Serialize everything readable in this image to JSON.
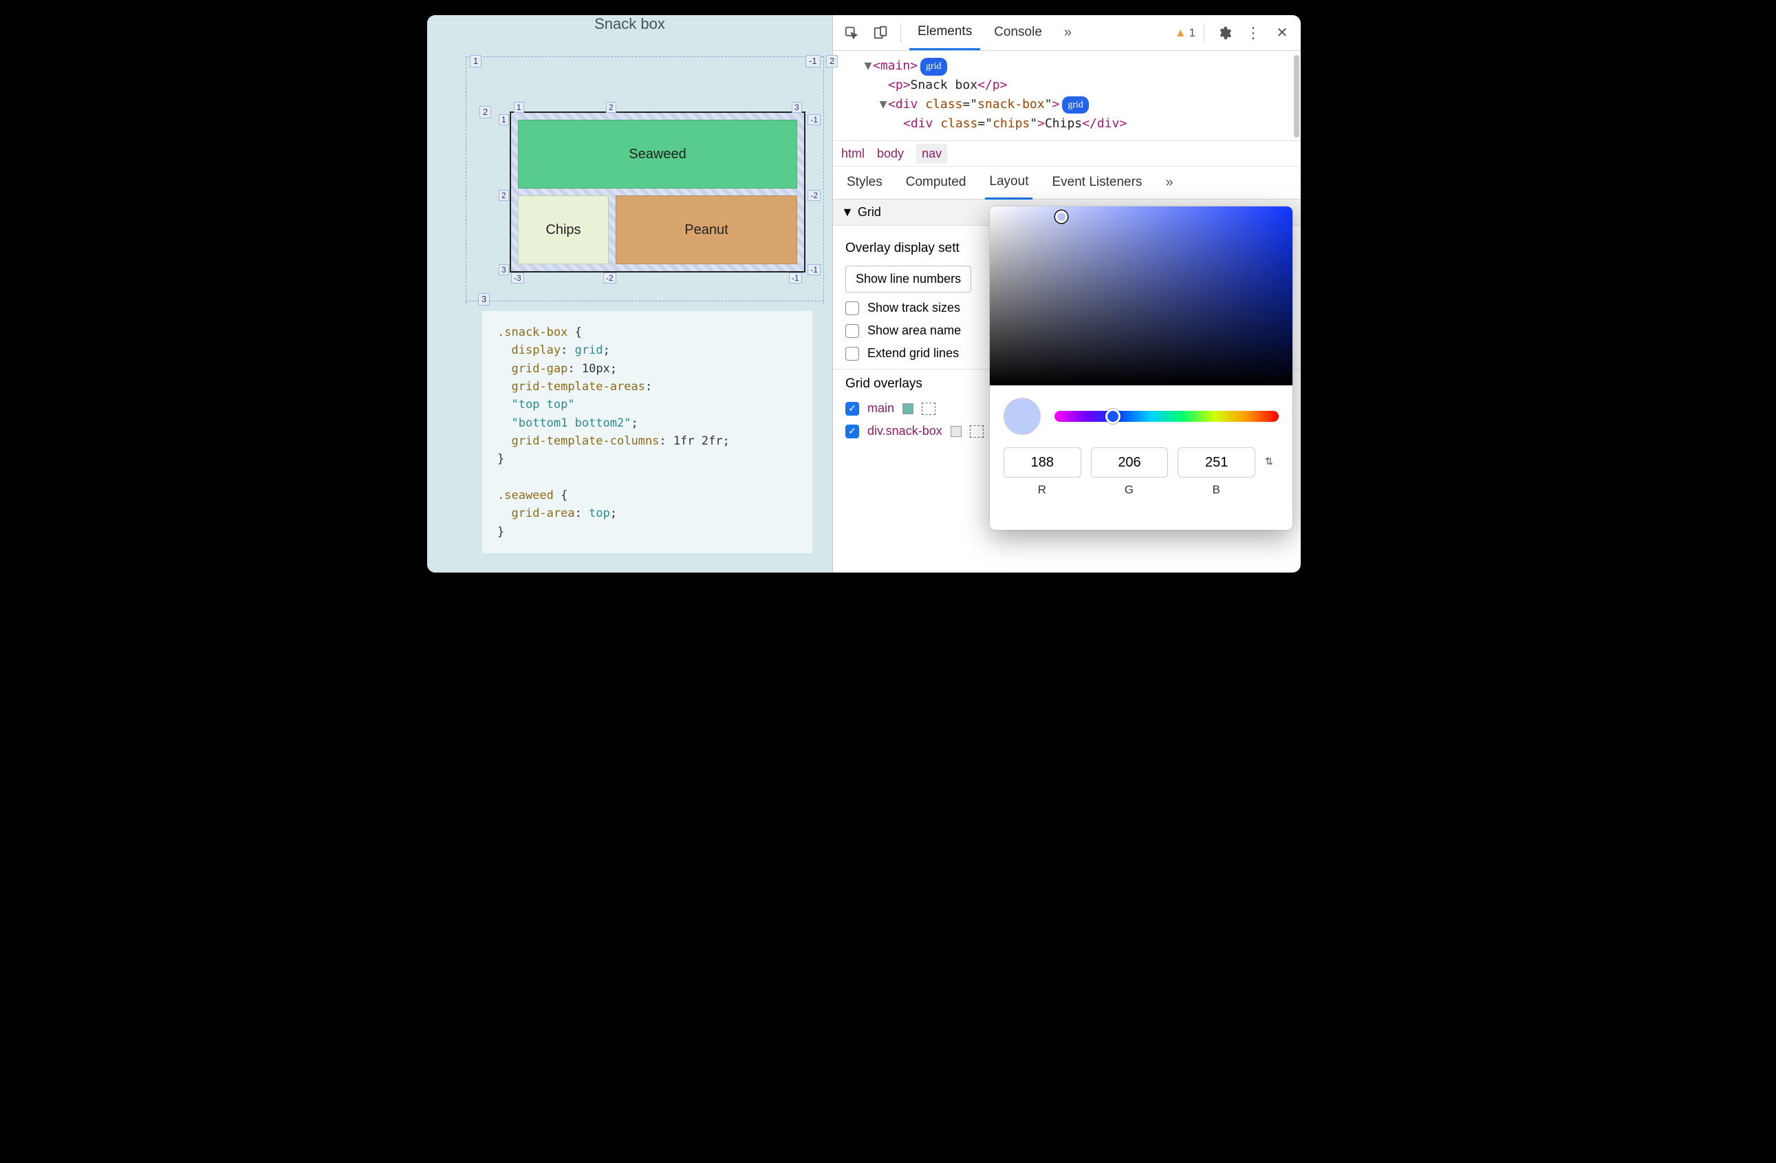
{
  "page": {
    "title": "Snack box",
    "gridItems": {
      "seaweed": "Seaweed",
      "chips": "Chips",
      "peanut": "Peanut"
    },
    "outerLines": {
      "tl": "1",
      "tr": "-1",
      "r": "2",
      "bl": "3"
    },
    "innerLines": {
      "top": [
        "1",
        "2",
        "3"
      ],
      "leftSide": [
        "1",
        "2",
        "3"
      ],
      "rightSide": [
        "-1",
        "-2",
        "-1"
      ],
      "bottom": [
        "-3",
        "-2",
        "-1"
      ]
    },
    "code": ".snack-box {\n  display: grid;\n  grid-gap: 10px;\n  grid-template-areas:\n  \"top top\"\n  \"bottom1 bottom2\";\n  grid-template-columns: 1fr 2fr;\n}\n\n.seaweed {\n  grid-area: top;\n}"
  },
  "toolbar": {
    "tabs": {
      "elements": "Elements",
      "console": "Console"
    },
    "moreGlyph": "»",
    "warnCount": "1"
  },
  "dom": {
    "l1": {
      "open": "<",
      "tag": "main",
      "close": ">",
      "badge": "grid"
    },
    "l2": {
      "open": "<",
      "tag": "p",
      "close": ">",
      "text": "Snack box",
      "endOpen": "</",
      "endClose": ">"
    },
    "l3": {
      "open": "<",
      "tag": "div",
      "attrName": "class",
      "attrVal": "snack-box",
      "close": ">",
      "badge": "grid"
    },
    "l4": {
      "open": "<",
      "tag": "div",
      "attrName": "class",
      "attrVal": "chips",
      "close": ">",
      "text": "Chips",
      "endOpen": "</",
      "endClose": ">"
    }
  },
  "crumbs": {
    "a": "html",
    "b": "body",
    "c": "nav"
  },
  "subtabs": {
    "styles": "Styles",
    "computed": "Computed",
    "layout": "Layout",
    "listeners": "Event Listeners",
    "more": "»"
  },
  "gridPanel": {
    "sectionTitle": "Grid",
    "overlayHeading": "Overlay display sett",
    "dropdown": "Show line numbers",
    "chkTrack": "Show track sizes",
    "chkArea": "Show area name",
    "chkExtend": "Extend grid lines",
    "overlaysHeading": "Grid overlays",
    "item1": "main",
    "item2": "div.snack-box",
    "swatch1": "#6fb8ad"
  },
  "picker": {
    "r": "188",
    "g": "206",
    "b": "251",
    "labR": "R",
    "labG": "G",
    "labB": "B",
    "swatch": "#bccdf9"
  }
}
